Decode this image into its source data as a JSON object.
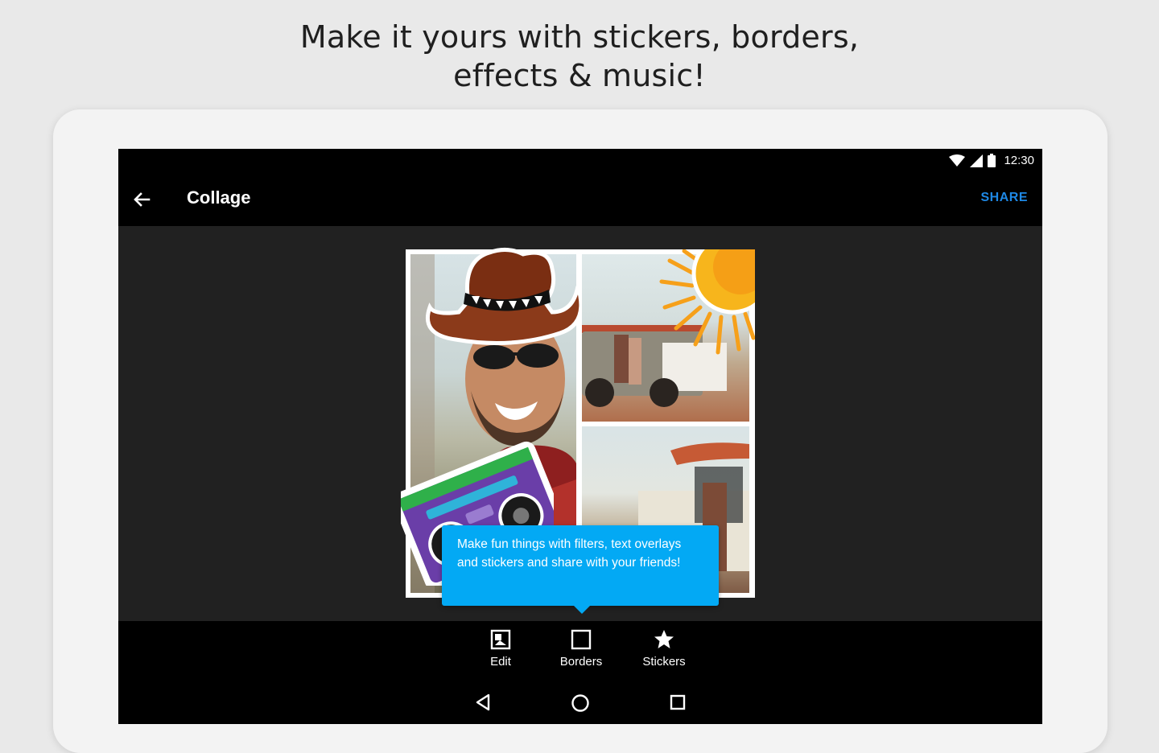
{
  "headline": {
    "line1": "Make it yours with stickers, borders,",
    "line2": "effects & music!"
  },
  "status_bar": {
    "time": "12:30",
    "icons": [
      "wifi-icon",
      "signal-icon",
      "battery-icon"
    ]
  },
  "app_bar": {
    "back_icon": "arrow-back-icon",
    "title": "Collage",
    "share_label": "SHARE"
  },
  "collage": {
    "photos": [
      "man-with-sunglasses-photo",
      "couple-by-jeep-photo",
      "jeep-with-canoe-photo"
    ],
    "stickers": [
      "cowboy-hat-sticker",
      "sun-sticker",
      "boombox-sticker"
    ]
  },
  "tooltip": {
    "text": "Make fun things with filters, text overlays and stickers and share with your friends!"
  },
  "bottom_tools": [
    {
      "label": "Edit",
      "icon": "edit-image-icon"
    },
    {
      "label": "Borders",
      "icon": "borders-square-icon"
    },
    {
      "label": "Stickers",
      "icon": "star-icon"
    }
  ],
  "nav_bar": [
    "back-triangle-icon",
    "home-circle-icon",
    "recents-square-icon"
  ],
  "colors": {
    "accent": "#1e88e5",
    "tooltip": "#03a9f4",
    "screen_bg": "#212121",
    "bar_bg": "#000000"
  }
}
